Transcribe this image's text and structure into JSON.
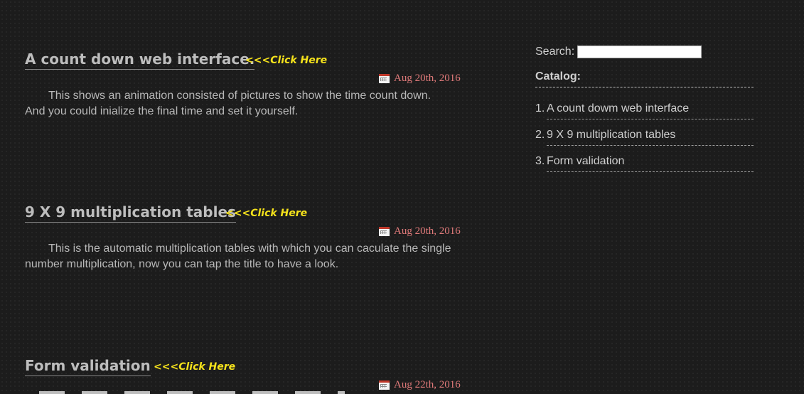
{
  "posts": [
    {
      "title": "A count down web interface.",
      "click_here": "<<<Click Here",
      "date": "Aug 20th, 2016",
      "body": "This shows an animation consisted of pictures to show the time count down. And you could inialize the final time and set it yourself."
    },
    {
      "title": "9 X 9 multiplication tables",
      "click_here": "<<<Click Here",
      "date": "Aug 20th, 2016",
      "body": "This is the automatic multiplication tables with which you can caculate the single number multiplication, now you can tap the title to have a look."
    },
    {
      "title": "Form validation",
      "click_here": "<<<Click Here",
      "date": "Aug 22th, 2016",
      "body": ""
    }
  ],
  "sidebar": {
    "search_label": "Search:",
    "search_value": "",
    "catalog_title": "Catalog:",
    "catalog": [
      {
        "num": "1.",
        "label": "A count dowm web interface"
      },
      {
        "num": "2.",
        "label": "9 X 9 multiplication tables"
      },
      {
        "num": "3.",
        "label": "Form validation"
      }
    ]
  },
  "colors": {
    "background": "#1c1c1c",
    "title": "#bdbdbd",
    "click_here": "#f5e21b",
    "date": "#e07a7a",
    "text": "#b8b8b8"
  },
  "icons": {
    "date_icon": "calendar-icon"
  }
}
